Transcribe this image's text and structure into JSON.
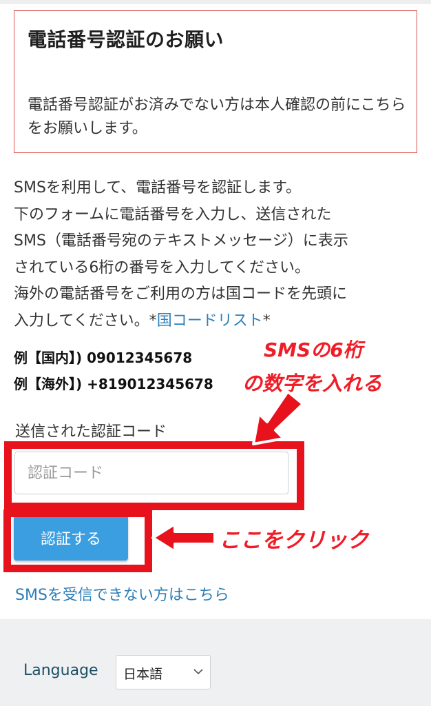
{
  "notice": {
    "title": "電話番号認証のお願い",
    "body": "電話番号認証がお済みでない方は本人確認の前にこちらをお願いします。"
  },
  "description": {
    "line1": "SMSを利用して、電話番号を認証します。",
    "line2": "下のフォームに電話番号を入力し、送信された",
    "line3": "SMS（電話番号宛のテキストメッセージ）に表示",
    "line4": "されている6桁の番号を入力してください。",
    "line5": "海外の電話番号をご利用の方は国コードを先頭に",
    "line6_prefix": "入力してください。*",
    "country_code_link": "国コードリスト",
    "line6_suffix": "*"
  },
  "examples": {
    "domestic": "例【国内】) 09012345678",
    "overseas": "例【海外】) +819012345678"
  },
  "code_field": {
    "label": "送信された認証コード",
    "placeholder": "認証コード"
  },
  "verify_button": {
    "label": "認証する"
  },
  "sms_help_link": "SMSを受信できない方はこちら",
  "footer": {
    "language_label": "Language",
    "language_value": "日本語"
  },
  "annotations": {
    "sms_digits_line1": "SMSの6桁",
    "sms_digits_line2": "の数字を入れる",
    "click_here": "ここをクリック",
    "accent_color": "#e8121c"
  }
}
